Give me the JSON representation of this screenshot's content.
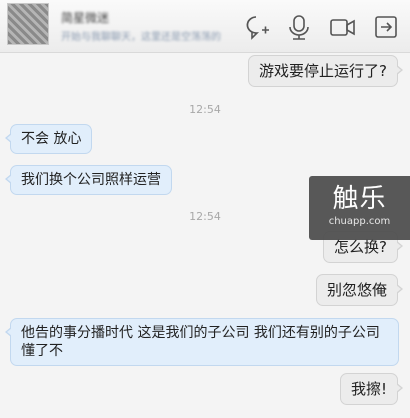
{
  "contact": {
    "name": "简星微迷",
    "signature": "开始与我聊聊天，这里还是空荡荡的"
  },
  "toolbar": {
    "icons": [
      "chat-add-icon",
      "microphone-icon",
      "video-call-icon",
      "share-icon"
    ]
  },
  "messages": [
    {
      "type": "out",
      "text": "游戏要停止运行了?"
    },
    {
      "type": "time",
      "text": "12:54"
    },
    {
      "type": "in",
      "text": "不会  放心"
    },
    {
      "type": "in",
      "text": "我们换个公司照样运营"
    },
    {
      "type": "time",
      "text": "12:54"
    },
    {
      "type": "out",
      "text": "怎么换?"
    },
    {
      "type": "out",
      "text": "别忽悠俺"
    },
    {
      "type": "in",
      "text": "他告的事分播时代  这是我们的子公司  我们还有别的子公司懂了不"
    },
    {
      "type": "out",
      "text": "我擦!"
    }
  ],
  "watermark": {
    "logo": "触乐",
    "url": "chuapp.com"
  },
  "colors": {
    "incoming_bubble": "#e1eefb",
    "outgoing_bubble": "#ececec",
    "timestamp": "#a8a8a8"
  }
}
